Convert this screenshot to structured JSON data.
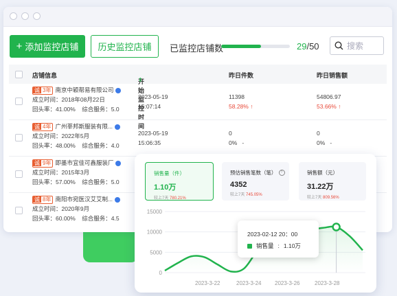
{
  "toolbar": {
    "add_label": "添加监控店铺",
    "history_label": "历史监控店铺",
    "monitored_label": "已监控店铺数",
    "monitored_current": "29",
    "monitored_total": "/50",
    "monitored_fraction": 0.58,
    "search_placeholder": "搜索"
  },
  "table": {
    "headers": {
      "store": "店铺信息",
      "start": "开始监控时间",
      "sales_count": "昨日件数",
      "sales_amount": "昨日销售额"
    },
    "rows": [
      {
        "tag_a": "诚",
        "tag_b": "3年",
        "name": "南京中颖帮易有限公司",
        "founded": "成立时间：2018年08月22日",
        "stats": "回头率：41.00%    综合服务：5.0",
        "start_date": "2023-05-19",
        "start_time": "15:07:14",
        "count_value": "11398",
        "count_change": "58.28%",
        "count_arrow": "↑",
        "amount_value": "54806.97",
        "amount_change": "53.66%",
        "amount_arrow": "↑"
      },
      {
        "tag_a": "诚",
        "tag_b": "4年",
        "name": "广州莘邦斯服装有限...",
        "founded": "成立时间：2022年5月",
        "stats": "回头率：48.00%    综合服务：4.0",
        "start_date": "2023-05-19",
        "start_time": "15:06:35",
        "count_value": "0",
        "count_change": "0%",
        "count_arrow": "-",
        "amount_value": "0",
        "amount_change": "0%",
        "amount_arrow": "-"
      },
      {
        "tag_a": "诚",
        "tag_b": "9年",
        "name": "即墨市宜佳可鑫服装厂",
        "founded": "成立时间：2015年3月",
        "stats": "回头率：57.00%    综合服务：5.0"
      },
      {
        "tag_a": "诚",
        "tag_b": "8年",
        "name": "南阳市宛医汉艾艾制...",
        "founded": "成立时间：2020年9月",
        "stats": "回头率：60.00%    综合服务：4.5"
      }
    ]
  },
  "metrics": [
    {
      "label": "销售量（件）",
      "value": "1.10万",
      "compare": "较上7天",
      "change": "780.21%"
    },
    {
      "label": "预估销售笔数（笔）",
      "value": "4352",
      "compare": "较上7天",
      "change": "745.05%"
    },
    {
      "label": "销售额（元）",
      "value": "31.22万",
      "compare": "较上7天",
      "change": "809.56%"
    }
  ],
  "tooltip": {
    "datetime": "2023-02-12 20：00",
    "series": "销售量",
    "value": "1.10万"
  },
  "colors": {
    "accent": "#21b34d",
    "up": "#e84a3a",
    "tag": "#e85d30"
  },
  "chart_data": {
    "type": "line",
    "x_ticks": [
      "2023-3-22",
      "2023-3-24",
      "2023-3-26",
      "2023-3-28"
    ],
    "y_ticks": [
      "15000",
      "10000",
      "5000",
      "0"
    ],
    "ylim": [
      0,
      15000
    ],
    "series": [
      {
        "x": [
          0,
          1,
          2,
          3,
          4,
          5,
          6,
          7,
          8,
          9,
          10,
          11,
          12,
          13,
          14,
          15
        ],
        "values": [
          500,
          2400,
          4000,
          3800,
          2000,
          300,
          1000,
          5500,
          10200,
          11000,
          10700,
          10600,
          11000,
          11200,
          9000,
          5500
        ]
      }
    ],
    "highlight_index": 13
  }
}
